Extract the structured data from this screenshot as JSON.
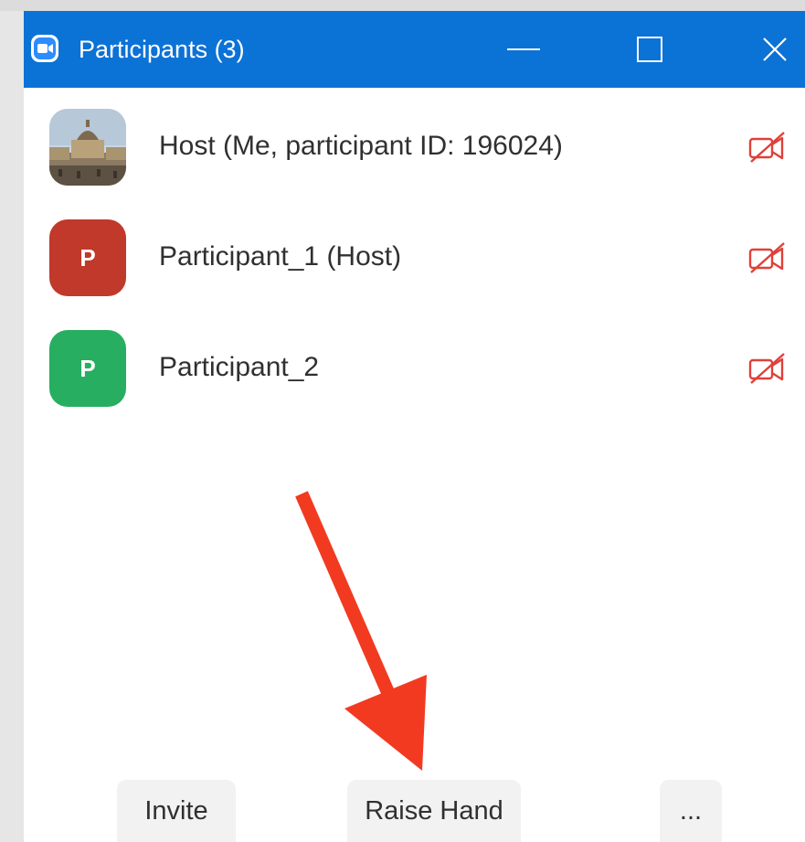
{
  "window": {
    "title": "Participants (3)"
  },
  "participants": [
    {
      "name": "Host (Me, participant ID: 196024)",
      "avatar": "photo",
      "video": "off"
    },
    {
      "name": "Participant_1 (Host)",
      "avatar_letter": "P",
      "avatar_color": "#c0392b",
      "video": "off"
    },
    {
      "name": "Participant_2",
      "avatar_letter": "P",
      "avatar_color": "#27ae60",
      "video": "off"
    }
  ],
  "footer": {
    "invite_label": "Invite",
    "raise_hand_label": "Raise Hand",
    "more_label": "..."
  },
  "colors": {
    "titlebar": "#0b72d6",
    "video_off_icon": "#e0403a",
    "annotation_arrow": "#f23a21"
  },
  "icons": {
    "app": "zoom-camera-icon",
    "minimize": "minimize-icon",
    "maximize": "maximize-icon",
    "close": "close-icon",
    "video_off": "video-off-icon"
  }
}
